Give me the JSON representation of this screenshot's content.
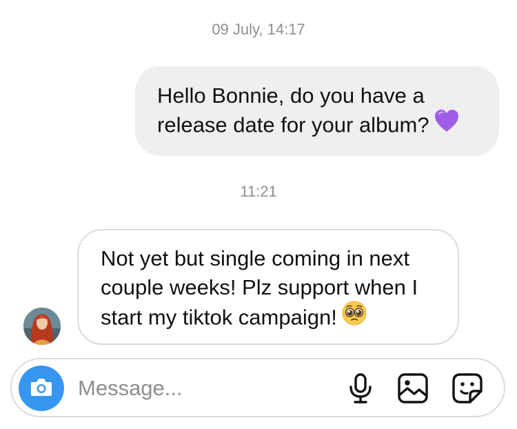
{
  "thread": {
    "timestamp_1": "09 July, 14:17",
    "outgoing_message": {
      "text": "Hello Bonnie, do you have a release date for your album?",
      "emoji": "purple-heart-emoji"
    },
    "timestamp_2": "11:21",
    "incoming_message": {
      "text": "Not yet but single coming in next couple weeks! Plz support when I start my tiktok campaign!",
      "emoji": "pleading-face-emoji"
    }
  },
  "composer": {
    "placeholder": "Message...",
    "value": "",
    "camera_icon": "camera-icon",
    "mic_icon": "microphone-icon",
    "gallery_icon": "image-gallery-icon",
    "sticker_icon": "sticker-icon"
  },
  "colors": {
    "accent": "#3797f0",
    "outgoing_bubble": "#efefef",
    "border": "#dbdbdb",
    "muted_text": "#8e8e8e"
  }
}
